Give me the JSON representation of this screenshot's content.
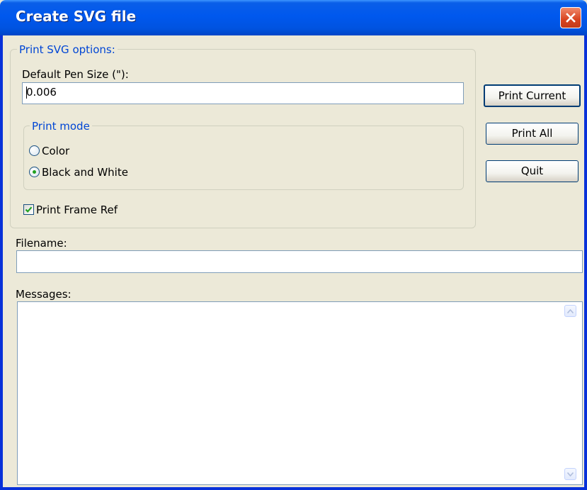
{
  "window": {
    "title": "Create SVG file",
    "close_icon": "close-icon"
  },
  "print_svg_options": {
    "legend": "Print SVG options:",
    "pen_size_label": "Default Pen Size (\"):",
    "pen_size_value": "0.006",
    "print_mode": {
      "legend": "Print mode",
      "options": [
        {
          "label": "Color",
          "selected": false
        },
        {
          "label": "Black and White",
          "selected": true
        }
      ]
    },
    "print_frame_ref": {
      "label": "Print Frame Ref",
      "checked": true
    }
  },
  "buttons": {
    "print_current": "Print Current",
    "print_all": "Print All",
    "quit": "Quit"
  },
  "filename": {
    "label": "Filename:",
    "value": ""
  },
  "messages": {
    "label": "Messages:",
    "value": ""
  },
  "colors": {
    "title_bar": "#0058EE",
    "dialog_bg": "#ECE9D8",
    "group_legend": "#0046D5",
    "close_button": "#D8431F"
  }
}
